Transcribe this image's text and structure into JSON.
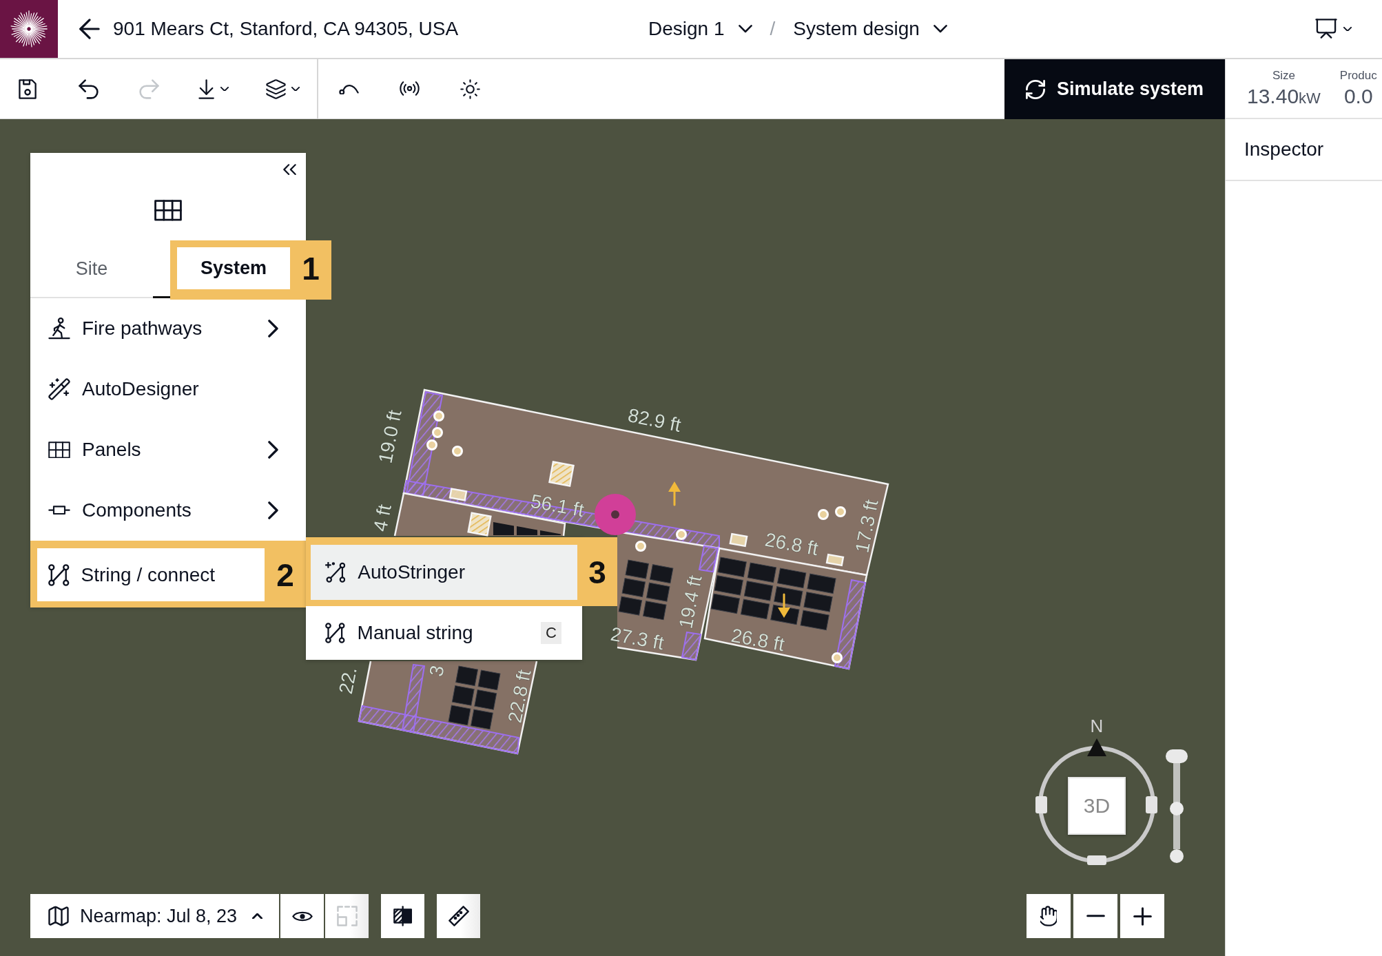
{
  "header": {
    "address": "901 Mears Ct, Stanford, CA 94305, USA",
    "breadcrumbs": [
      {
        "label": "Design 1"
      },
      {
        "label": "System design"
      }
    ],
    "separator": "/"
  },
  "toolbar": {
    "buttons": [
      {
        "disabled": false
      },
      {
        "disabled": false
      },
      {
        "disabled": true
      },
      {
        "disabled": false
      },
      {
        "disabled": false
      },
      {
        "disabled": false
      },
      {
        "disabled": false
      },
      {
        "disabled": false
      }
    ],
    "simulate_button": {
      "label": "Simulate system"
    }
  },
  "stats": [
    {
      "label": "Size",
      "value": "13.40",
      "unit": "kW"
    },
    {
      "label": "Produc",
      "value": "0.0"
    }
  ],
  "inspector": {
    "title": "Inspector"
  },
  "left_panel": {
    "tabs": [
      {
        "label": "Site",
        "selected": false
      },
      {
        "label": "System",
        "selected": true,
        "annotation": "1"
      }
    ],
    "items": [
      {
        "label": "Fire pathways",
        "submenu": true
      },
      {
        "label": "AutoDesigner",
        "submenu": false
      },
      {
        "label": "Panels",
        "submenu": true
      },
      {
        "label": "Components",
        "submenu": true
      },
      {
        "label": "String / connect",
        "submenu": false,
        "annotation": "2"
      }
    ]
  },
  "submenu": {
    "items": [
      {
        "label": "AutoStringer",
        "selected": true,
        "annotation": "3"
      },
      {
        "label": "Manual string",
        "selected": false,
        "shortcut": "C"
      }
    ]
  },
  "map": {
    "dimension_labels": [
      "82.9 ft",
      "19.0 ft",
      "56.1 ft",
      "4 ft",
      "17.3 ft",
      "26.8 ft",
      "19.4 ft",
      "27.3 ft",
      "26.8 ft",
      "3",
      "22.",
      "22.8 ft"
    ]
  },
  "map_controls": {
    "imagery": {
      "label": "Nearmap: Jul 8, 23"
    },
    "tools": [
      {
        "disabled": false
      },
      {
        "disabled": true
      },
      {
        "disabled": false
      },
      {
        "disabled": false
      }
    ]
  },
  "compass": {
    "north_label": "N",
    "view_button": "3D"
  },
  "tilt_slider": {
    "level": 0.47
  }
}
